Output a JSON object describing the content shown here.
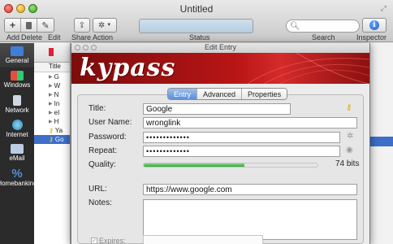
{
  "window": {
    "title": "Untitled"
  },
  "toolbar": {
    "add_label": "Add",
    "delete_label": "Delete",
    "edit_label": "Edit",
    "share_label": "Share",
    "action_label": "Action",
    "status_label": "Status",
    "search_label": "Search",
    "inspector_label": "Inspector"
  },
  "groups": [
    {
      "label": "General",
      "icon": "folder-icon",
      "color": "#3f7fd8"
    },
    {
      "label": "Windows",
      "icon": "windows-icon",
      "color": "#e6c33a"
    },
    {
      "label": "Network",
      "icon": "network-icon",
      "color": "#5aa0d8"
    },
    {
      "label": "Internet",
      "icon": "globe-icon",
      "color": "#3aa0c8"
    },
    {
      "label": "eMail",
      "icon": "mail-icon",
      "color": "#8aaed8"
    },
    {
      "label": "Homebanking",
      "icon": "percent-icon",
      "color": "#4f8fe0"
    }
  ],
  "entry_list": {
    "column_header": "Title",
    "rows": [
      {
        "text": "G"
      },
      {
        "text": "W"
      },
      {
        "text": "N"
      },
      {
        "text": "In"
      },
      {
        "text": "eI"
      },
      {
        "text": "H"
      },
      {
        "text": "Ya"
      },
      {
        "text": "Go"
      }
    ]
  },
  "sheet": {
    "title": "Edit Entry",
    "logo_text": "kypass",
    "tabs": [
      "Entry",
      "Advanced",
      "Properties"
    ],
    "active_tab": "Entry",
    "fields": {
      "title_label": "Title:",
      "title_value": "Google",
      "username_label": "User Name:",
      "username_value": "wronglink",
      "password_label": "Password:",
      "password_value": "•••••••••••••",
      "repeat_label": "Repeat:",
      "repeat_value": "•••••••••••••",
      "quality_label": "Quality:",
      "quality_fraction": 0.58,
      "quality_text": "74 bits",
      "url_label": "URL:",
      "url_value": "https://www.google.com",
      "notes_label": "Notes:",
      "notes_value": "",
      "expires_label": "Expires:"
    }
  },
  "colors": {
    "accent_blue": "#3d6ec9",
    "banner_red": "#b81515",
    "quality_green": "#2fa33a",
    "sidebar_dark": "#2b2b2b"
  }
}
